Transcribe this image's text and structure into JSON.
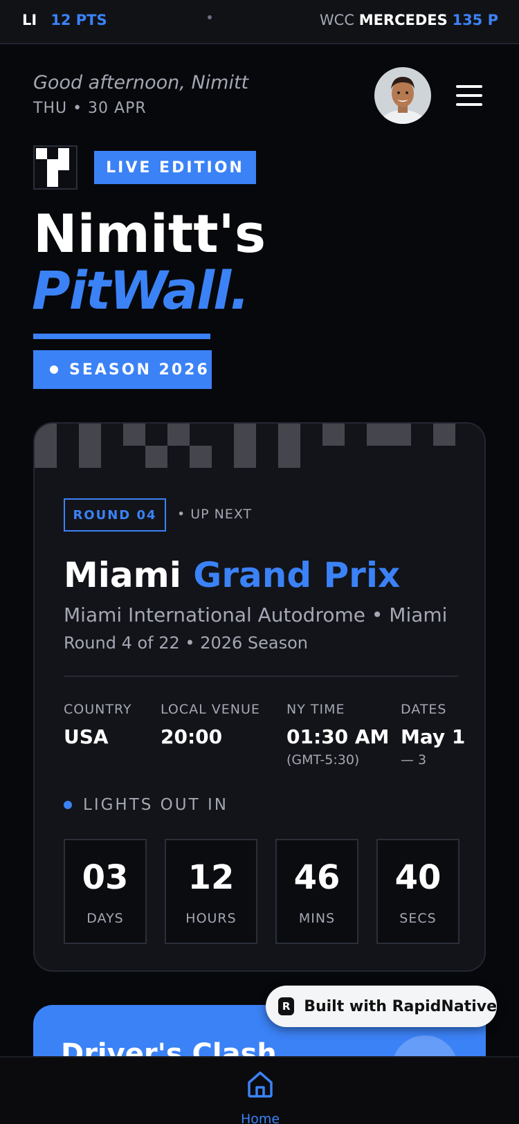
{
  "ticker": {
    "left_label": "LI",
    "left_points": "12 PTS",
    "right_prefix": "WCC",
    "right_team": "MERCEDES",
    "right_points": "135 P"
  },
  "header": {
    "greeting": "Good afternoon, Nimitt",
    "date": "THU • 30 APR"
  },
  "edition_label": "LIVE EDITION",
  "title": {
    "line1": "Nimitt's",
    "line2": "PitWall."
  },
  "season_label": "SEASON 2026",
  "race": {
    "round_badge": "ROUND 04",
    "up_next": "• UP NEXT",
    "name_part1": "Miami",
    "name_part2": "Grand Prix",
    "venue": "Miami International Autodrome • Miami",
    "round_info": "Round 4 of 22 • 2026 Season",
    "info": [
      {
        "label": "COUNTRY",
        "value": "USA",
        "sub": ""
      },
      {
        "label": "LOCAL VENUE",
        "value": "20:00",
        "sub": ""
      },
      {
        "label": "NY TIME",
        "value": "01:30 AM",
        "sub": "(GMT-5:30)"
      },
      {
        "label": "DATES",
        "value": "May 1",
        "sub": "— 3"
      }
    ],
    "lights_label": "LIGHTS OUT IN",
    "countdown": [
      {
        "value": "03",
        "unit": "DAYS"
      },
      {
        "value": "12",
        "unit": "HOURS"
      },
      {
        "value": "46",
        "unit": "MINS"
      },
      {
        "value": "40",
        "unit": "SECS"
      }
    ]
  },
  "clash": {
    "title": "Driver's Clash"
  },
  "built_with": "Built with RapidNative",
  "nav": {
    "home_label": "Home"
  },
  "colors": {
    "accent": "#3b82f6",
    "background": "#07080b",
    "card": "#131419",
    "muted_text": "#a4a8b4"
  },
  "icons": {
    "menu": "hamburger-menu-icon",
    "home": "home-icon",
    "brand": "rapidnative-logo-icon"
  }
}
